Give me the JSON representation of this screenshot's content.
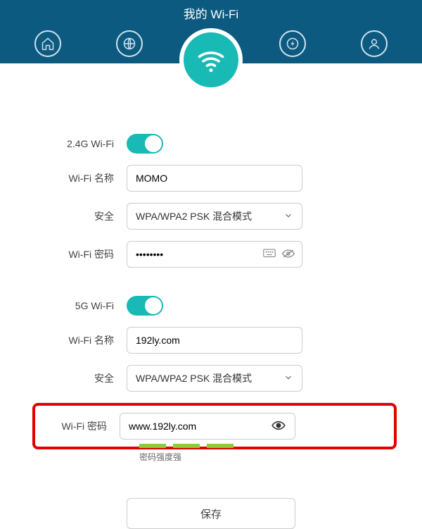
{
  "header": {
    "title": "我的 Wi-Fi"
  },
  "sections": {
    "g24": {
      "enable_label": "2.4G Wi-Fi",
      "name_label": "Wi-Fi 名称",
      "name_value": "MOMO",
      "security_label": "安全",
      "security_value": "WPA/WPA2 PSK 混合模式",
      "password_label": "Wi-Fi 密码",
      "password_value": "••••••••"
    },
    "g5": {
      "enable_label": "5G Wi-Fi",
      "name_label": "Wi-Fi 名称",
      "name_value": "192ly.com",
      "security_label": "安全",
      "security_value": "WPA/WPA2 PSK 混合模式",
      "password_label": "Wi-Fi 密码",
      "password_value": "www.192ly.com"
    }
  },
  "strength": {
    "label": "密码强度强"
  },
  "actions": {
    "save": "保存"
  }
}
